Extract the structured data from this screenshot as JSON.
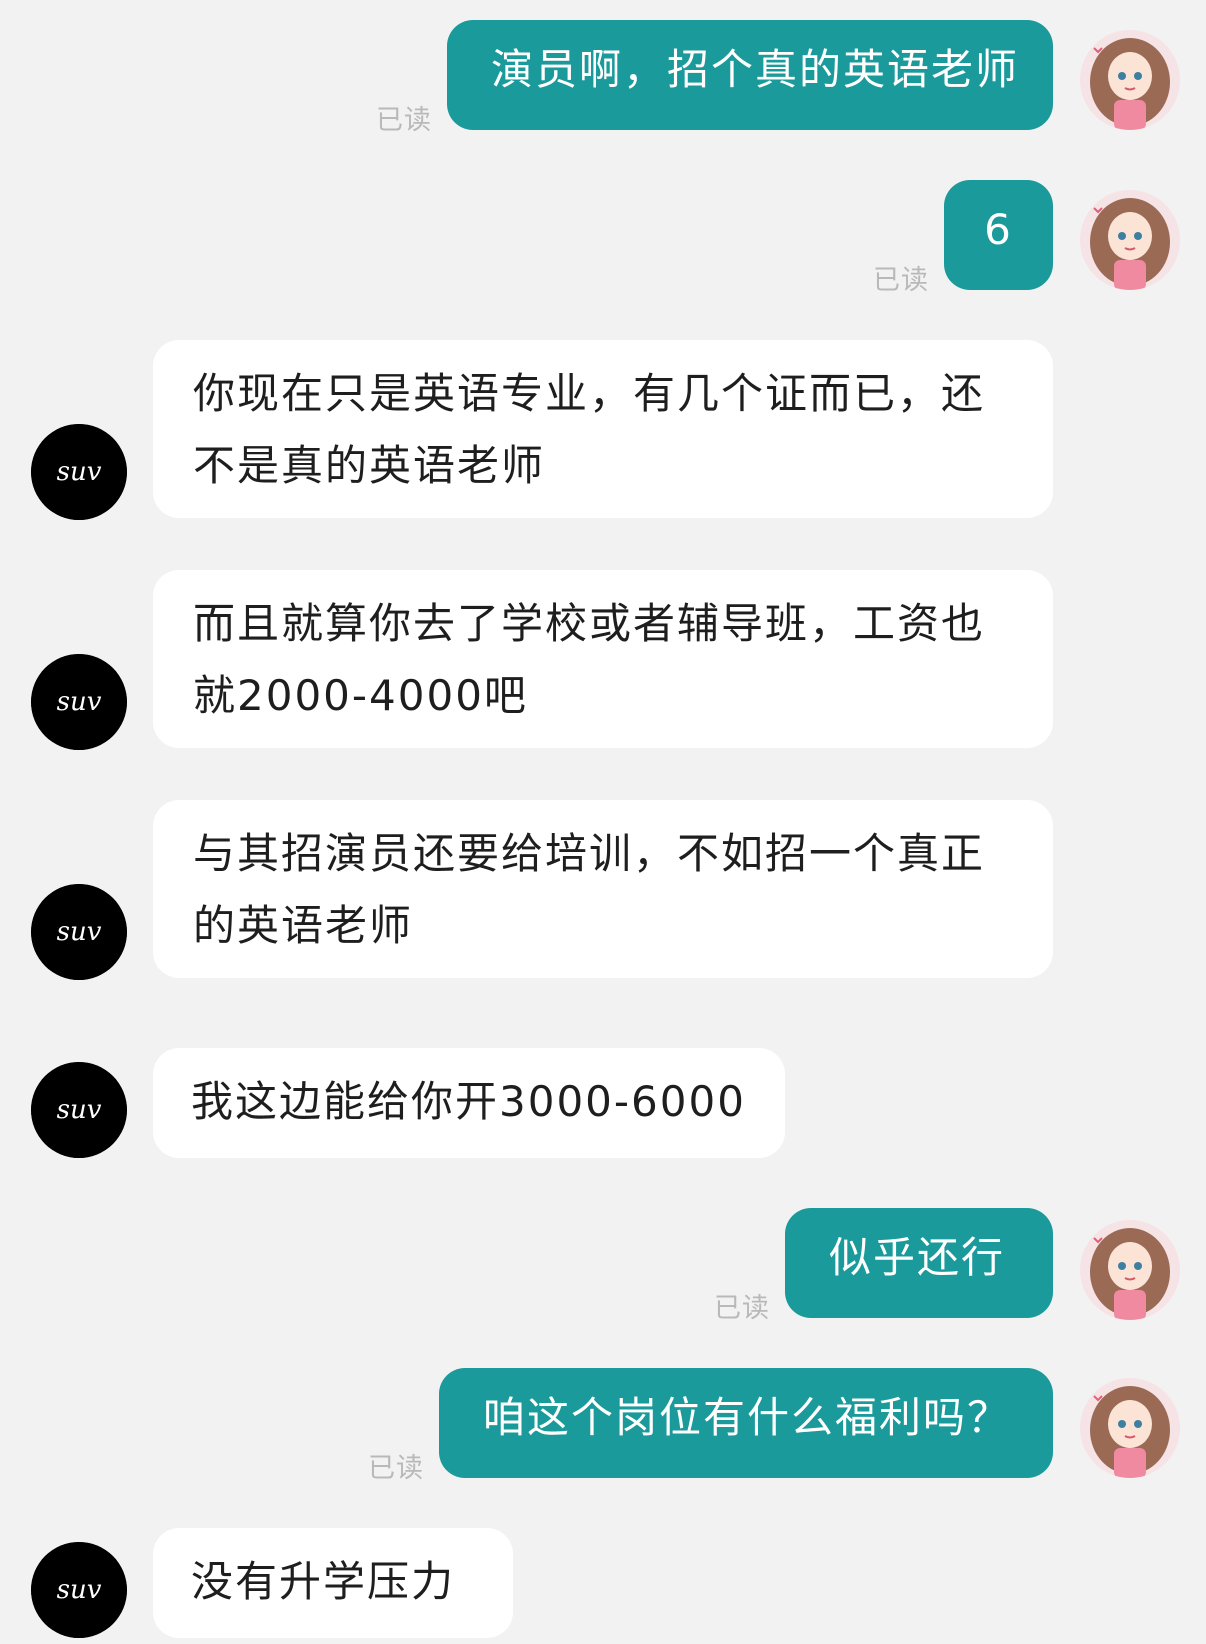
{
  "conversation": {
    "messages": [
      {
        "id": "m1",
        "direction": "outgoing",
        "text": "演员啊，招个真的英语老师",
        "status": "已读"
      },
      {
        "id": "m2",
        "direction": "outgoing",
        "text": "6",
        "status": "已读"
      },
      {
        "id": "m3",
        "direction": "incoming",
        "text": "你现在只是英语专业，有几个证而已，还不是真的英语老师"
      },
      {
        "id": "m4",
        "direction": "incoming",
        "text": "而且就算你去了学校或者辅导班，工资也就2000-4000吧"
      },
      {
        "id": "m5",
        "direction": "incoming",
        "text": "与其招演员还要给培训，不如招一个真正的英语老师"
      },
      {
        "id": "m6",
        "direction": "incoming",
        "text": "我这边能给你开3000-6000"
      },
      {
        "id": "m7",
        "direction": "outgoing",
        "text": "似乎还行",
        "status": "已读"
      },
      {
        "id": "m8",
        "direction": "outgoing",
        "text": "咱这个岗位有什么福利吗？",
        "status": "已读"
      },
      {
        "id": "m9",
        "direction": "incoming",
        "text": "没有升学压力"
      }
    ]
  },
  "contact": {
    "avatar_text": "suv",
    "avatar_color": "#000000"
  },
  "self": {
    "avatar_icon": "cartoon-girl-avatar"
  },
  "colors": {
    "outgoing_bubble": "#1a9a9b",
    "incoming_bubble": "#ffffff",
    "background": "#f2f2f2",
    "read_status": "#b9b9b9"
  }
}
